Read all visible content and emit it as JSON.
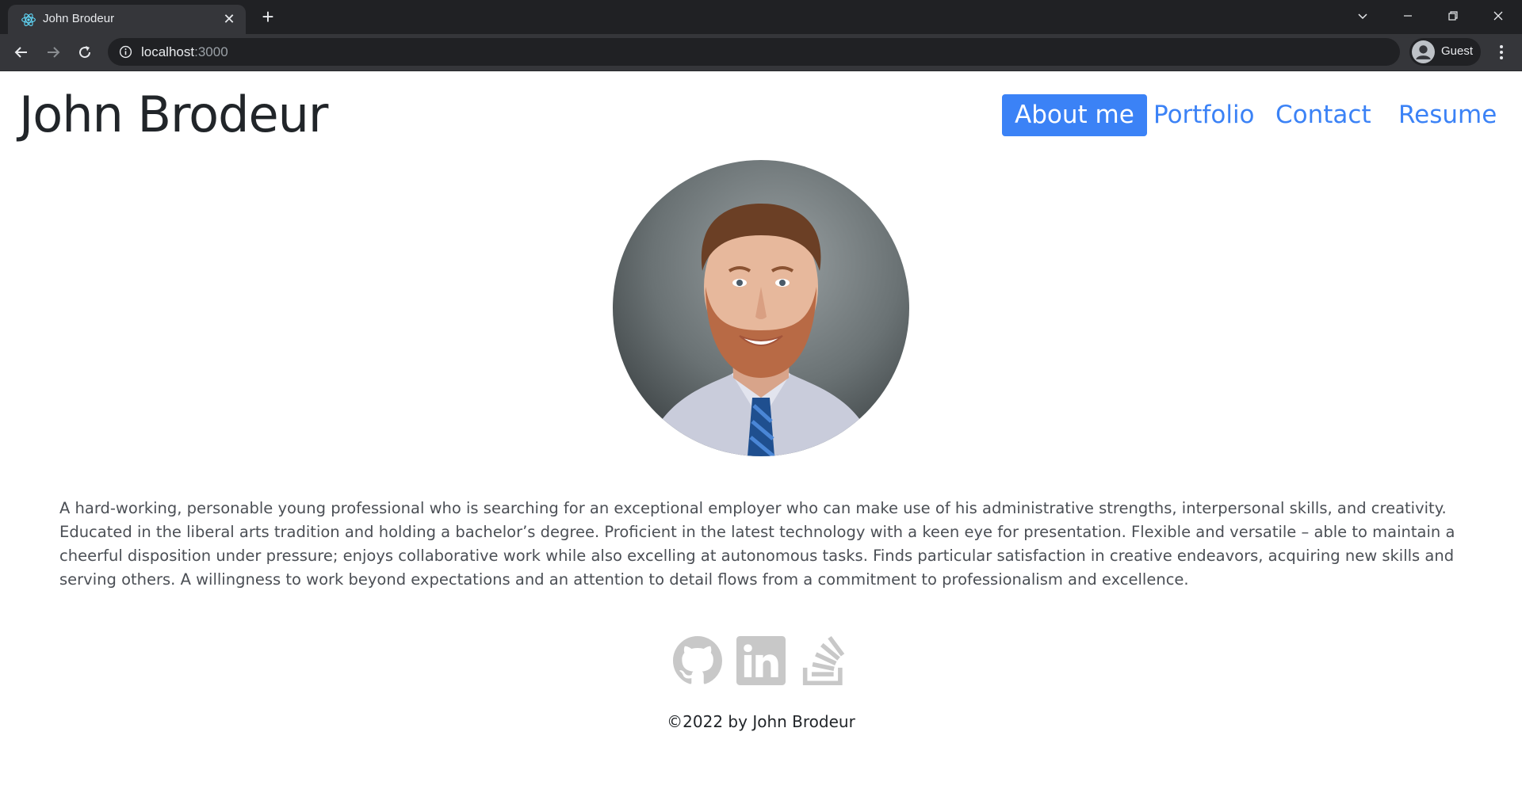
{
  "browser": {
    "tab_title": "John Brodeur",
    "tab_favicon": "react-logo-icon",
    "address_host": "localhost",
    "address_port": ":3000",
    "profile_label": "Guest"
  },
  "header": {
    "site_title": "John Brodeur",
    "nav": [
      {
        "label": "About me",
        "active": true
      },
      {
        "label": "Portfolio",
        "active": false
      },
      {
        "label": "Contact",
        "active": false
      },
      {
        "label": "Resume",
        "active": false
      }
    ]
  },
  "about": {
    "portrait_alt": "Portrait photo of John Brodeur",
    "bio": "A hard-working, personable young professional who is searching for an exceptional employer who can make use of his administrative strengths, interpersonal skills, and creativity. Educated in the liberal arts tradition and holding a bachelor’s degree. Proficient in the latest technology with a keen eye for presentation. Flexible and versatile – able to maintain a cheerful disposition under pressure; enjoys collaborative work while also excelling at autonomous tasks. Finds particular satisfaction in creative endeavors, acquiring new skills and serving others. A willingness to work beyond expectations and an attention to detail flows from a commitment to professionalism and excellence."
  },
  "footer": {
    "social_icons": [
      "github-icon",
      "linkedin-icon",
      "stackoverflow-icon"
    ],
    "copyright": "©2022 by John Brodeur"
  },
  "colors": {
    "accent": "#3b82f6",
    "chrome_dark": "#202124",
    "chrome_tab": "#35363a",
    "social_icon": "#c8c8c8",
    "text": "#212529"
  }
}
